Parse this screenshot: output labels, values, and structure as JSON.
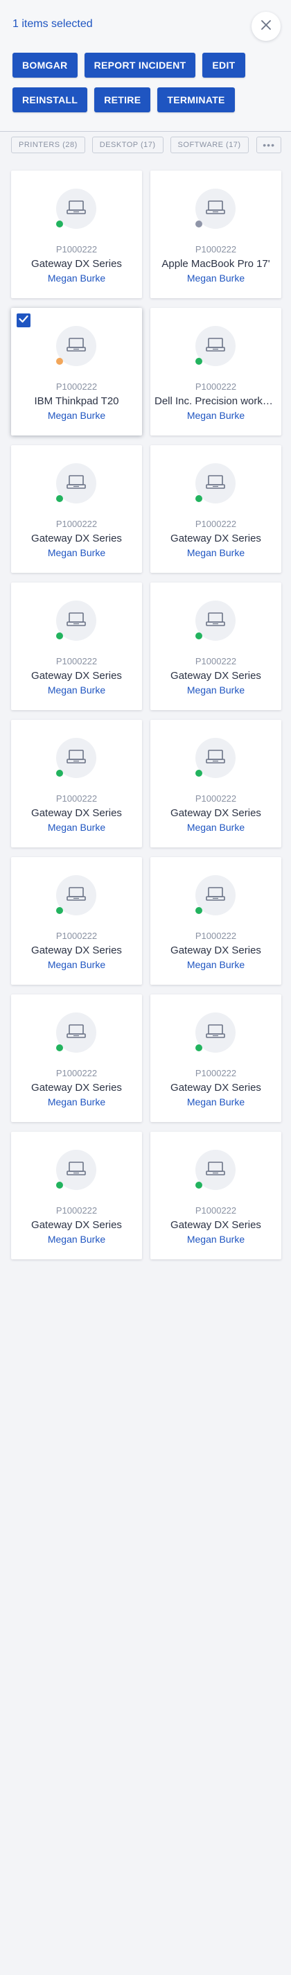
{
  "header": {
    "selected_text": "1 items selected",
    "close_icon": "close-icon"
  },
  "actions": {
    "row1": [
      "BOMGAR",
      "REPORT INCIDENT",
      "EDIT"
    ],
    "row2": [
      "REINSTALL",
      "RETIRE",
      "TERMINATE"
    ]
  },
  "filters": [
    "PRINTERS (28)",
    "DESKTOP (17)",
    "SOFTWARE (17)"
  ],
  "more_label": "•••",
  "colors": {
    "accent": "#1f55c1",
    "status_green": "#22b35e",
    "status_gray": "#8f95a8",
    "status_orange": "#f2a65a"
  },
  "cards": [
    {
      "id": "P1000222",
      "name": "Gateway DX Series",
      "owner": "Megan Burke",
      "status": "green",
      "selected": false
    },
    {
      "id": "P1000222",
      "name": "Apple MacBook Pro 17'",
      "owner": "Megan Burke",
      "status": "gray",
      "selected": false
    },
    {
      "id": "P1000222",
      "name": "IBM Thinkpad T20",
      "owner": "Megan Burke",
      "status": "orange",
      "selected": true
    },
    {
      "id": "P1000222",
      "name": "Dell Inc. Precision workstation",
      "owner": "Megan Burke",
      "status": "green",
      "selected": false
    },
    {
      "id": "P1000222",
      "name": "Gateway DX Series",
      "owner": "Megan Burke",
      "status": "green",
      "selected": false
    },
    {
      "id": "P1000222",
      "name": "Gateway DX Series",
      "owner": "Megan Burke",
      "status": "green",
      "selected": false
    },
    {
      "id": "P1000222",
      "name": "Gateway DX Series",
      "owner": "Megan Burke",
      "status": "green",
      "selected": false
    },
    {
      "id": "P1000222",
      "name": "Gateway DX Series",
      "owner": "Megan Burke",
      "status": "green",
      "selected": false
    },
    {
      "id": "P1000222",
      "name": "Gateway DX Series",
      "owner": "Megan Burke",
      "status": "green",
      "selected": false
    },
    {
      "id": "P1000222",
      "name": "Gateway DX Series",
      "owner": "Megan Burke",
      "status": "green",
      "selected": false
    },
    {
      "id": "P1000222",
      "name": "Gateway DX Series",
      "owner": "Megan Burke",
      "status": "green",
      "selected": false
    },
    {
      "id": "P1000222",
      "name": "Gateway DX Series",
      "owner": "Megan Burke",
      "status": "green",
      "selected": false
    },
    {
      "id": "P1000222",
      "name": "Gateway DX Series",
      "owner": "Megan Burke",
      "status": "green",
      "selected": false
    },
    {
      "id": "P1000222",
      "name": "Gateway DX Series",
      "owner": "Megan Burke",
      "status": "green",
      "selected": false
    },
    {
      "id": "P1000222",
      "name": "Gateway DX Series",
      "owner": "Megan Burke",
      "status": "green",
      "selected": false
    },
    {
      "id": "P1000222",
      "name": "Gateway DX Series",
      "owner": "Megan Burke",
      "status": "green",
      "selected": false
    }
  ]
}
